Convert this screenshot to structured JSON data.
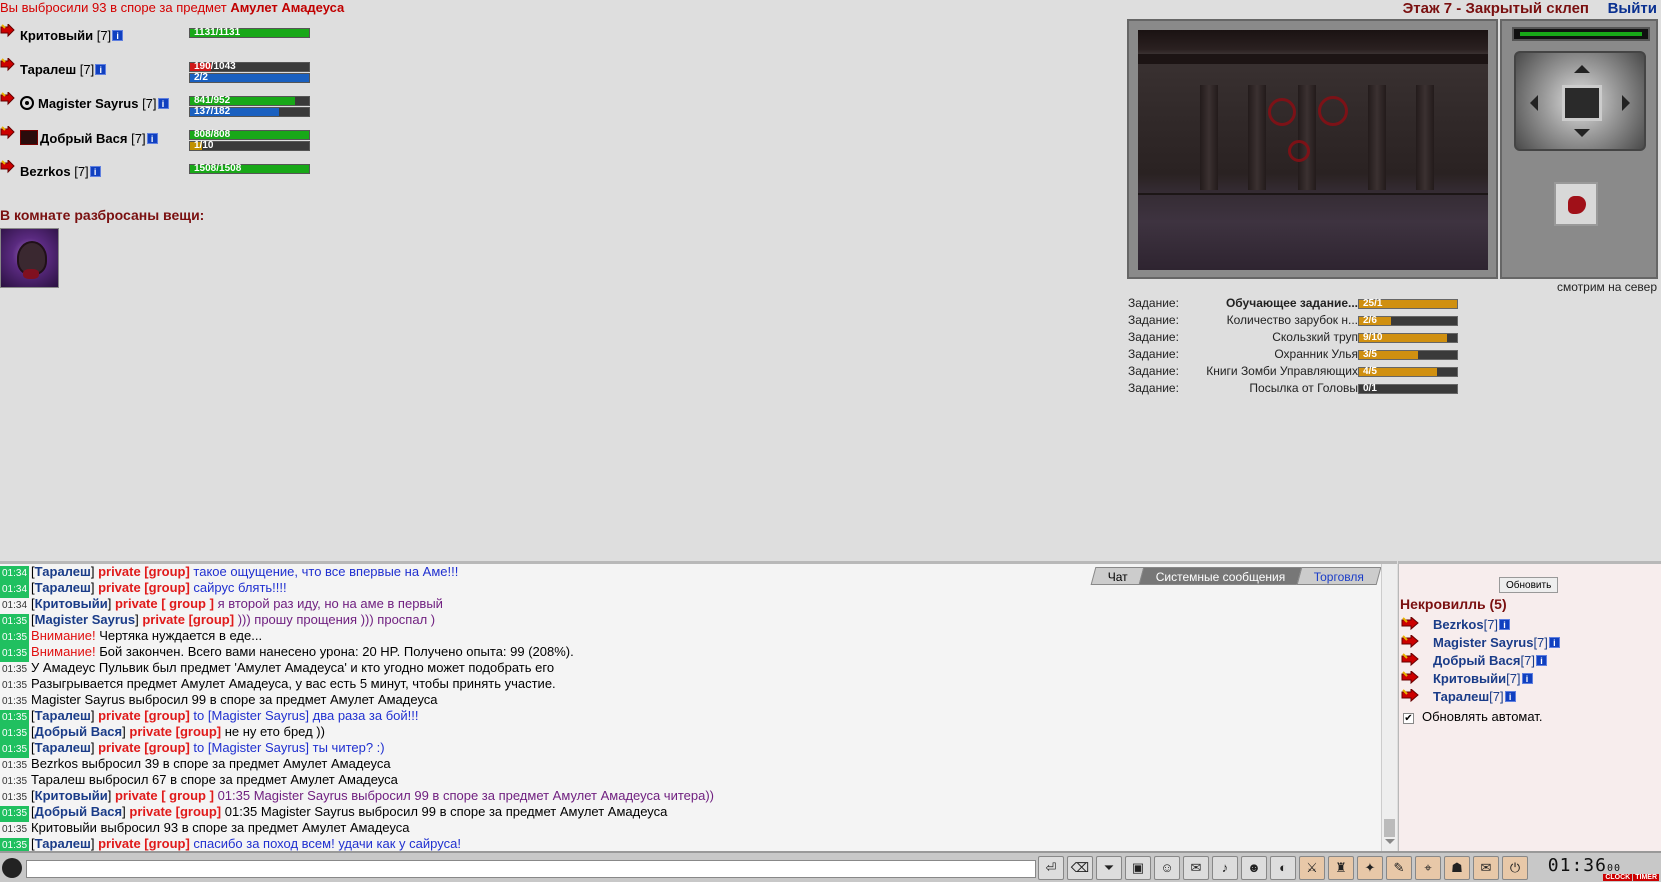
{
  "top_message": {
    "text": "Вы выбросили 93 в споре за предмет ",
    "item": "Амулет Амадеуса"
  },
  "header": {
    "location": "Этаж 7 - Закрытый склеп",
    "exit_label": "Выйти"
  },
  "party": [
    {
      "name": "Критовыйи",
      "level": "[7]",
      "hp": "1131/1131",
      "hp_frac": 1.0
    },
    {
      "name": "Таралеш",
      "level": "[7]",
      "hp": "190/1043",
      "hp_frac": 0.18,
      "mp": "2/2",
      "mp_frac": 1.0
    },
    {
      "name": "Magister Sayrus",
      "level": "[7]",
      "hp": "841/952",
      "hp_frac": 0.88,
      "mp": "137/182",
      "mp_frac": 0.75
    },
    {
      "name": "Добрый Вася",
      "level": "[7]",
      "hp": "808/808",
      "hp_frac": 1.0,
      "ep": "1/10",
      "ep_frac": 0.1
    },
    {
      "name": "Bezrkos",
      "level": "[7]",
      "hp": "1508/1508",
      "hp_frac": 1.0
    }
  ],
  "info_glyph": "i",
  "items": {
    "title": "В комнате разбросаны вещи:"
  },
  "view": {
    "facing": "смотрим на север"
  },
  "quests": {
    "label": "Задание:",
    "list": [
      {
        "name": "Обучающее задание...",
        "progress": "25/1",
        "frac": 1.0,
        "bold": true
      },
      {
        "name": "Количество зарубок н...",
        "progress": "2/6",
        "frac": 0.33
      },
      {
        "name": "Скользкий труп",
        "progress": "9/10",
        "frac": 0.9
      },
      {
        "name": "Охранник Улья",
        "progress": "3/5",
        "frac": 0.6
      },
      {
        "name": "Книги Зомби Управляющих",
        "progress": "4/5",
        "frac": 0.8
      },
      {
        "name": "Посылка от Головы",
        "progress": "0/1",
        "frac": 0.0
      }
    ]
  },
  "chat": {
    "tabs": {
      "chat": "Чат",
      "system": "Системные сообщения",
      "trade": "Торговля"
    },
    "lines": [
      {
        "ts": "01:34",
        "hi": true,
        "nick": "Таралеш",
        "priv": "private [group]",
        "text": "такое ощущение, что все впервые на Аме!!!",
        "style": "blue"
      },
      {
        "ts": "01:34",
        "hi": true,
        "nick": "Таралеш",
        "priv": "private [group]",
        "text": "сайрус блять!!!!",
        "style": "blue"
      },
      {
        "ts": "01:34",
        "hi": false,
        "nick": "Критовыйи",
        "priv": "private [ group ]",
        "text": "я второй раз иду, но на аме в первый",
        "style": "purple"
      },
      {
        "ts": "01:35",
        "hi": true,
        "nick": "Magister Sayrus",
        "priv": "private [group]",
        "text": "))) прошу прощения ))) проспал )",
        "style": "purple"
      },
      {
        "ts": "01:35",
        "hi": true,
        "warn": "Внимание!",
        "text": "Чертяка нуждается в еде..."
      },
      {
        "ts": "01:35",
        "hi": true,
        "warn": "Внимание!",
        "text": "Бой закончен. Всего вами нанесено урона: 20 HP. Получено опыта: 99 (208%)."
      },
      {
        "ts": "01:35",
        "hi": false,
        "text": "У Амадеус Пульвик был предмет 'Амулет Амадеуса' и кто угодно может подобрать его"
      },
      {
        "ts": "01:35",
        "hi": false,
        "text": "Разыгрывается предмет Амулет Амадеуса, у вас есть 5 минут, чтобы принять участие."
      },
      {
        "ts": "01:35",
        "hi": false,
        "text": "Magister Sayrus выбросил 99 в споре за предмет Амулет Амадеуса"
      },
      {
        "ts": "01:35",
        "hi": true,
        "nick": "Таралеш",
        "priv": "private [group]",
        "text": "to [Magister Sayrus] два раза за бой!!!",
        "style": "blue"
      },
      {
        "ts": "01:35",
        "hi": true,
        "nick": "Добрый Вася",
        "priv": "private [group]",
        "text": "не ну ето бред ))",
        "style": ""
      },
      {
        "ts": "01:35",
        "hi": true,
        "nick": "Таралеш",
        "priv": "private [group]",
        "text": "to [Magister Sayrus] ты читер? :)",
        "style": "blue"
      },
      {
        "ts": "01:35",
        "hi": false,
        "text": "Bezrkos выбросил 39 в споре за предмет Амулет Амадеуса"
      },
      {
        "ts": "01:35",
        "hi": false,
        "text": "Таралеш выбросил 67 в споре за предмет Амулет Амадеуса"
      },
      {
        "ts": "01:35",
        "hi": false,
        "nick": "Критовыйи",
        "priv": "private [ group ]",
        "text": "01:35 Magister Sayrus выбросил 99 в споре за предмет Амулет Амадеуса читера))",
        "style": "purple"
      },
      {
        "ts": "01:35",
        "hi": true,
        "nick": "Добрый Вася",
        "priv": "private [group]",
        "text": "01:35 Magister Sayrus выбросил 99 в споре за предмет Амулет Амадеуса",
        "style": ""
      },
      {
        "ts": "01:35",
        "hi": false,
        "text": "Критовыйи выбросил 93 в споре за предмет Амулет Амадеуса"
      },
      {
        "ts": "01:35",
        "hi": true,
        "nick": "Таралеш",
        "priv": "private [group]",
        "text": "спасибо за поход всем! удачи как у сайруса!",
        "style": "blue"
      }
    ]
  },
  "online": {
    "refresh_label": "Обновить",
    "room_title": "Некровилль (5)",
    "users": [
      {
        "name": "Bezrkos",
        "level": "[7]"
      },
      {
        "name": "Magister Sayrus",
        "level": "[7]"
      },
      {
        "name": "Добрый Вася",
        "level": "[7]"
      },
      {
        "name": "Критовыйи",
        "level": "[7]"
      },
      {
        "name": "Таралеш",
        "level": "[7]"
      }
    ],
    "auto_label": "Обновлять автомат.",
    "auto_checked": true
  },
  "bottom": {
    "input_value": "",
    "clock": "01:36",
    "clock_sec": "00",
    "clock_label": "CLOCK",
    "timer_label": "TIMER"
  },
  "colors": {
    "hp": "#18a818",
    "hp_low": "#d01818",
    "mp": "#1a60c0",
    "quest": "#d09010",
    "accent": "#7a1010"
  }
}
